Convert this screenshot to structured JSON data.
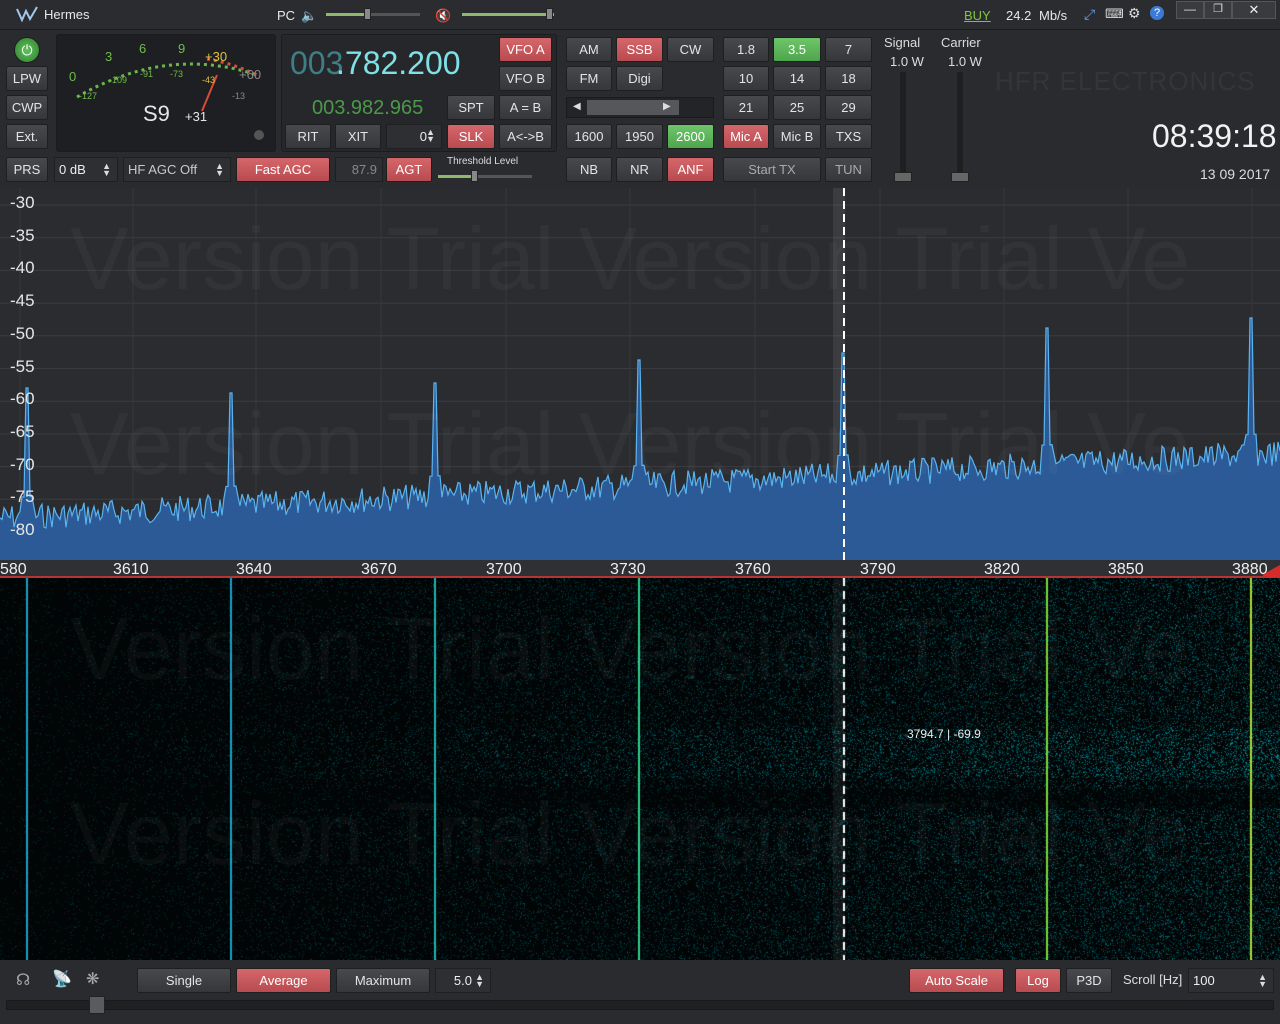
{
  "titlebar": {
    "app_name": "Hermes",
    "pc_label": "PC",
    "buy_label": "BUY",
    "rate": "24.2",
    "rate_unit": "Mb/s"
  },
  "meter": {
    "scale_top": [
      "0",
      "3",
      "6",
      "9",
      "+30",
      "+60"
    ],
    "scale_bottom": [
      "-127",
      "-109",
      "-91",
      "-73",
      "-43",
      "-13"
    ],
    "s_value": "S9",
    "s_over": "+31"
  },
  "left_buttons": {
    "lpw": "LPW",
    "cwp": "CWP",
    "ext": "Ext."
  },
  "vfo": {
    "main_dim": "003",
    "main_bright": ".782.200",
    "sub": "003.982.965",
    "vfo_a": "VFO A",
    "vfo_b": "VFO B",
    "spt": "SPT",
    "a_eq_b": "A = B",
    "rit": "RIT",
    "xit": "XIT",
    "rit_value": "0",
    "slk": "SLK",
    "swap": "A<->B"
  },
  "agc": {
    "prs": "PRS",
    "gain": "0 dB",
    "agc_mode": "HF AGC Off",
    "fast_agc": "Fast AGC",
    "level": "87.9",
    "agt": "AGT",
    "threshold_label": "Threshold Level"
  },
  "modes": {
    "am": "AM",
    "ssb": "SSB",
    "cw": "CW",
    "fm": "FM",
    "digi": "Digi"
  },
  "filters": {
    "f1600": "1600",
    "f1950": "1950",
    "f2600": "2600",
    "nb": "NB",
    "nr": "NR",
    "anf": "ANF"
  },
  "bands": [
    "1.8",
    "3.5",
    "7",
    "10",
    "14",
    "18",
    "21",
    "25",
    "29"
  ],
  "tx": {
    "mic_a": "Mic A",
    "mic_b": "Mic B",
    "txs": "TXS",
    "start_tx": "Start TX",
    "tun": "TUN"
  },
  "power": {
    "signal_label": "Signal",
    "signal_value": "1.0 W",
    "carrier_label": "Carrier",
    "carrier_value": "1.0 W"
  },
  "brand": "HFR ELECTRONICS",
  "clock": {
    "time": "08:39:18",
    "date": "13 09 2017"
  },
  "spectrum": {
    "y_labels": [
      "-30",
      "-35",
      "-40",
      "-45",
      "-50",
      "-55",
      "-60",
      "-65",
      "-70",
      "-75",
      "-80"
    ],
    "x_labels": [
      "580",
      "3610",
      "3640",
      "3670",
      "3700",
      "3730",
      "3760",
      "3790",
      "3820",
      "3850",
      "3880"
    ],
    "watermark": "Version   Trial Version   Trial Ve"
  },
  "waterfall": {
    "cursor_readout": "3794.7 | -69.9"
  },
  "bottom": {
    "single": "Single",
    "average": "Average",
    "maximum": "Maximum",
    "avg_value": "5.0",
    "auto_scale": "Auto Scale",
    "log": "Log",
    "p3d": "P3D",
    "scroll_label": "Scroll [Hz]",
    "scroll_value": "100"
  },
  "colors": {
    "accent_red": "#c9565b",
    "accent_green": "#5cb85a",
    "spectrum_line": "#5ab4f0",
    "spectrum_fill": "#2c5a96"
  }
}
